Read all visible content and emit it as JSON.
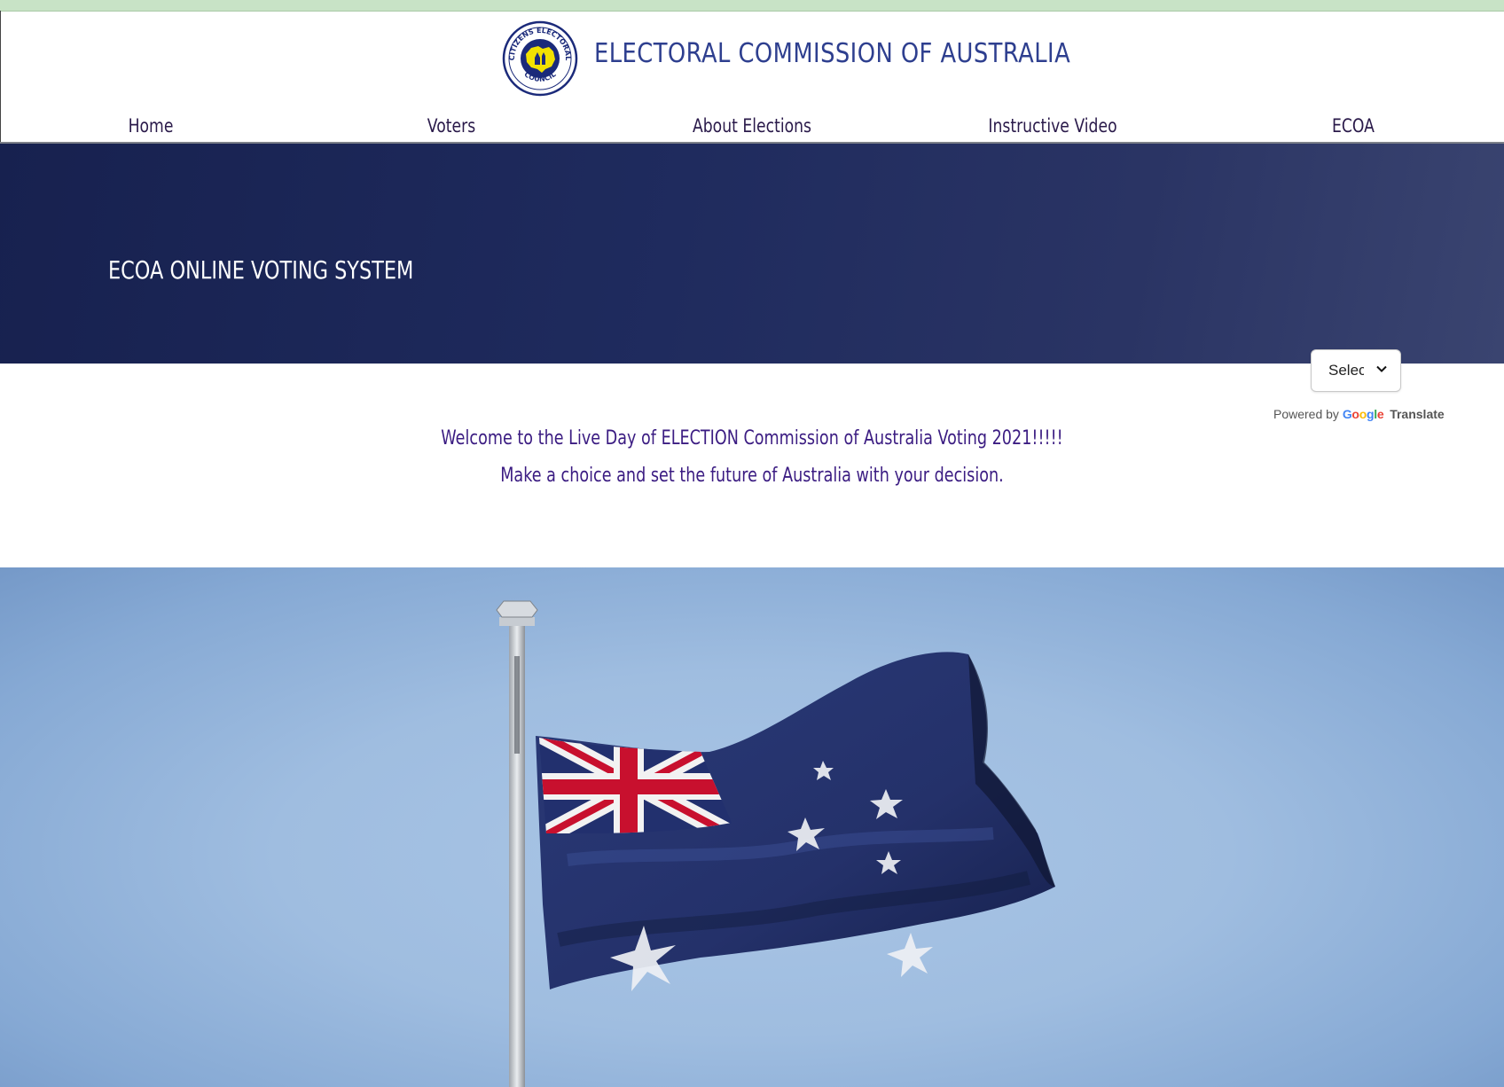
{
  "header": {
    "logo": {
      "ring_text_top": "CITIZENS ELECTORAL",
      "ring_text_bottom": "COUNCIL"
    },
    "title": "ELECTORAL COMMISSION OF AUSTRALIA"
  },
  "nav": {
    "items": [
      {
        "label": "Home"
      },
      {
        "label": "Voters"
      },
      {
        "label": "About Elections"
      },
      {
        "label": "Instructive Video"
      },
      {
        "label": "ECOA"
      }
    ]
  },
  "banner": {
    "title": "ECOA ONLINE VOTING SYSTEM"
  },
  "translate": {
    "select_value": "Select Language",
    "powered_by": "Powered by",
    "google": "Google",
    "translate": "Translate"
  },
  "welcome": {
    "line1": "Welcome to the Live Day of ELECTION Commission of Australia Voting 2021!!!!!",
    "line2": "Make a choice and set the future of Australia with your decision."
  },
  "colors": {
    "brand": "#2e3f8f",
    "banner": "#1c2757",
    "welcome_text": "#3b1c82",
    "nav_text": "#2a1a4a"
  },
  "icons": {
    "logo": "citizens-electoral-council-logo",
    "select_arrow": "chevron-down-icon",
    "hero": "australian-flag-photo"
  }
}
